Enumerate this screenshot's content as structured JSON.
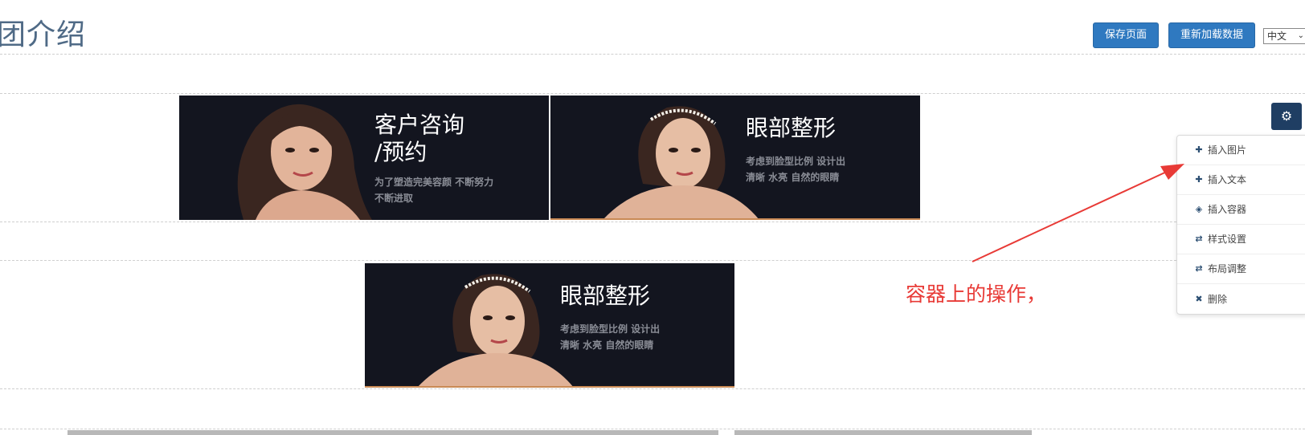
{
  "page": {
    "title": "团介绍"
  },
  "toolbar": {
    "save_label": "保存页面",
    "reload_label": "重新加载数据"
  },
  "language": {
    "selected": "中文"
  },
  "banners": [
    {
      "title": "客户咨询\n/预约",
      "subtitle": "为了塑造完美容颜  不断努力\n不断进取"
    },
    {
      "title": "眼部整形",
      "subtitle": "考虑到脸型比例  设计出\n清晰  水亮  自然的眼睛"
    },
    {
      "title": "眼部整形",
      "subtitle": "考虑到脸型比例  设计出\n清晰  水亮  自然的眼睛"
    }
  ],
  "container_menu": {
    "gear_icon": "gear-icon",
    "items": [
      {
        "icon": "plus-icon",
        "label": "插入图片"
      },
      {
        "icon": "plus-icon",
        "label": "插入文本"
      },
      {
        "icon": "cube-icon",
        "label": "插入容器"
      },
      {
        "icon": "retweet-icon",
        "label": "样式设置"
      },
      {
        "icon": "retweet-icon",
        "label": "布局调整"
      },
      {
        "icon": "close-icon",
        "label": "删除"
      }
    ]
  },
  "annotation": {
    "text": "容器上的操作，"
  },
  "colors": {
    "primary": "#2f79c0",
    "gear": "#1f3e63",
    "annotation": "#e83a36",
    "banner_bg": "#13151f"
  }
}
